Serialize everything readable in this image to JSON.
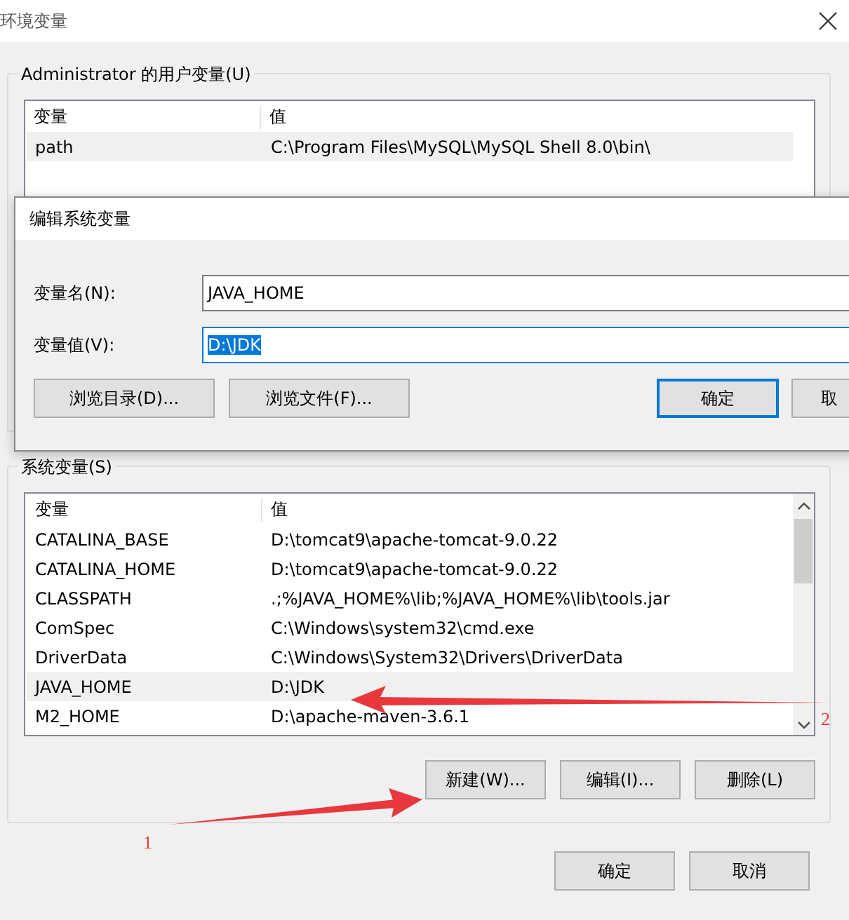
{
  "window": {
    "title": "环境变量"
  },
  "user_vars": {
    "label": "Administrator 的用户变量(U)",
    "columns": [
      "变量",
      "值"
    ],
    "rows": [
      {
        "name": "path",
        "value": "C:\\Program Files\\MySQL\\MySQL Shell 8.0\\bin\\",
        "selected": true
      }
    ]
  },
  "edit_dialog": {
    "title": "编辑系统变量",
    "name_label": "变量名(N):",
    "name_value": "JAVA_HOME",
    "value_label": "变量值(V):",
    "value_value": "D:\\JDK",
    "buttons": [
      {
        "label": "浏览目录(D)...",
        "default": false
      },
      {
        "label": "浏览文件(F)...",
        "default": false
      },
      {
        "label": "确定",
        "default": true
      },
      {
        "label": "取",
        "default": false
      }
    ]
  },
  "system_vars": {
    "label": "系统变量(S)",
    "columns": [
      "变量",
      "值"
    ],
    "rows": [
      {
        "name": "CATALINA_BASE",
        "value": "D:\\tomcat9\\apache-tomcat-9.0.22",
        "selected": false
      },
      {
        "name": "CATALINA_HOME",
        "value": "D:\\tomcat9\\apache-tomcat-9.0.22",
        "selected": false
      },
      {
        "name": "CLASSPATH",
        "value": ".;%JAVA_HOME%\\lib;%JAVA_HOME%\\lib\\tools.jar",
        "selected": false
      },
      {
        "name": "ComSpec",
        "value": "C:\\Windows\\system32\\cmd.exe",
        "selected": false
      },
      {
        "name": "DriverData",
        "value": "C:\\Windows\\System32\\Drivers\\DriverData",
        "selected": false
      },
      {
        "name": "JAVA_HOME",
        "value": "D:\\JDK",
        "selected": true
      },
      {
        "name": "M2_HOME",
        "value": "D:\\apache-maven-3.6.1",
        "selected": false
      }
    ],
    "buttons": [
      "新建(W)...",
      "编辑(I)...",
      "删除(L)"
    ]
  },
  "buttons": [
    "确定",
    "取消"
  ],
  "annotations": [
    "1",
    "2"
  ]
}
